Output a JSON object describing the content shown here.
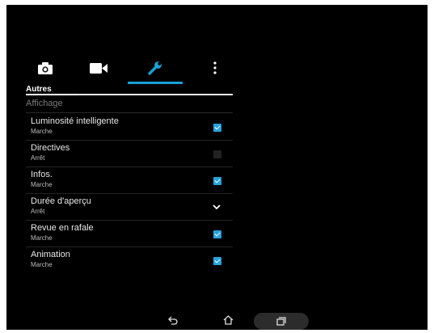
{
  "tabs": [
    {
      "icon": "camera-icon",
      "active": false
    },
    {
      "icon": "video-camera-icon",
      "active": false
    },
    {
      "icon": "wrench-icon",
      "active": true
    },
    {
      "icon": "more-vert-icon",
      "active": false
    }
  ],
  "section": {
    "title": "Autres"
  },
  "group": {
    "title": "Affichage"
  },
  "settings": [
    {
      "title": "Luminosité intelligente",
      "status": "Marche",
      "control": "checkbox",
      "checked": true
    },
    {
      "title": "Directives",
      "status": "Arrêt",
      "control": "checkbox",
      "checked": false
    },
    {
      "title": "Infos.",
      "status": "Marche",
      "control": "checkbox",
      "checked": true
    },
    {
      "title": "Durée d'aperçu",
      "status": "Arrêt",
      "control": "dropdown"
    },
    {
      "title": "Revue en rafale",
      "status": "Marche",
      "control": "checkbox",
      "checked": true
    },
    {
      "title": "Animation",
      "status": "Marche",
      "control": "checkbox",
      "checked": true
    }
  ],
  "navbar": {
    "back": "back-icon",
    "home": "home-icon",
    "recents": "recents-icon"
  },
  "colors": {
    "accent": "#19a0d8",
    "checkbox_on": "#27a3df",
    "background": "#000000"
  }
}
